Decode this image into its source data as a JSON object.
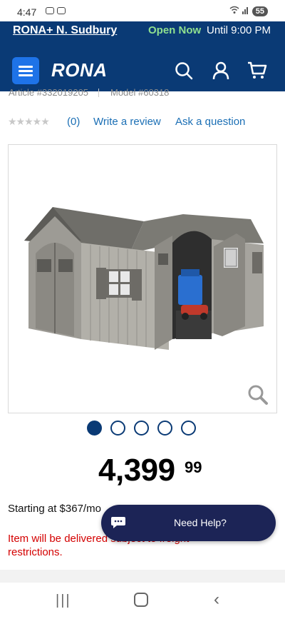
{
  "status": {
    "time": "4:47",
    "battery": "55"
  },
  "store": {
    "name": "RONA+ N. Sudbury",
    "open_label": "Open Now",
    "hours": "Until 9:00 PM"
  },
  "header": {
    "logo": "RONA",
    "icons": [
      "menu-icon",
      "search-icon",
      "account-icon",
      "cart-icon"
    ]
  },
  "product": {
    "article": "Article #332019205",
    "model": "Model #60318",
    "rating_stars": "★★★★★",
    "review_count": "(0)",
    "write_review": "Write a review",
    "ask_question": "Ask a question",
    "image_count": 5,
    "active_image": 1,
    "price_main": "4,399",
    "price_cents": "99",
    "financing": "Starting at $367/mo",
    "delivery_note": "Item will be delivered subject to freight restrictions."
  },
  "chat": {
    "label": "Need Help?"
  },
  "colors": {
    "brand_navy": "#0a3a75",
    "accent_blue": "#1e73e8",
    "link": "#1b6fb5",
    "open_green": "#8fe08f",
    "alert_red": "#d40000",
    "chat_bg": "#1c2456"
  }
}
